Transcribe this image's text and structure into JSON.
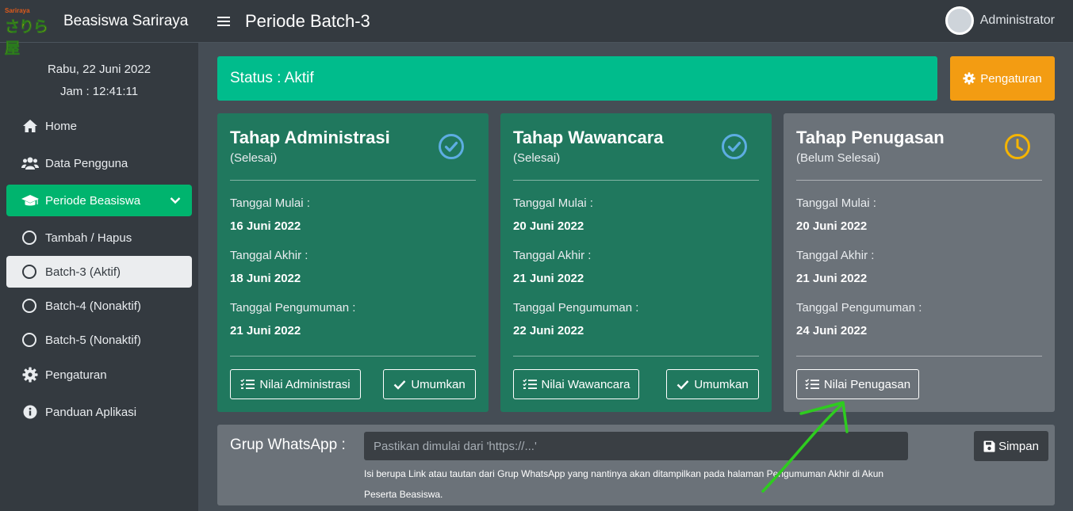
{
  "brand": {
    "logo_small": "Sariraya",
    "logo_big": "さりら屋",
    "name": "Beasiswa Sariraya"
  },
  "datetime": {
    "date": "Rabu, 22 Juni 2022",
    "time": "Jam : 12:41:11"
  },
  "nav": {
    "home": "Home",
    "users": "Data Pengguna",
    "periods": "Periode Beasiswa",
    "sub": [
      "Tambah / Hapus",
      "Batch-3 (Aktif)",
      "Batch-4 (Nonaktif)",
      "Batch-5 (Nonaktif)"
    ],
    "settings": "Pengaturan",
    "guide": "Panduan Aplikasi"
  },
  "header": {
    "title": "Periode Batch-3",
    "user": "Administrator"
  },
  "status": {
    "text": "Status : Aktif",
    "settings_button": "Pengaturan"
  },
  "labels": {
    "start": "Tanggal Mulai :",
    "end": "Tanggal Akhir :",
    "announce": "Tanggal Pengumuman :"
  },
  "cards": [
    {
      "title": "Tahap Administrasi",
      "status": "(Selesai)",
      "start": "16 Juni 2022",
      "end": "18 Juni 2022",
      "announce": "21 Juni 2022",
      "score_button": "Nilai Administrasi",
      "announce_button": "Umumkan"
    },
    {
      "title": "Tahap Wawancara",
      "status": "(Selesai)",
      "start": "20 Juni 2022",
      "end": "21 Juni 2022",
      "announce": "22 Juni 2022",
      "score_button": "Nilai Wawancara",
      "announce_button": "Umumkan"
    },
    {
      "title": "Tahap Penugasan",
      "status": "(Belum Selesai)",
      "start": "20 Juni 2022",
      "end": "21 Juni 2022",
      "announce": "24 Juni 2022",
      "score_button": "Nilai Penugasan"
    }
  ],
  "whatsapp": {
    "label": "Grup WhatsApp :",
    "placeholder": "Pastikan dimulai dari 'https://...'",
    "help": "Isi berupa Link atau tautan dari Grup WhatsApp yang nantinya akan ditampilkan pada halaman Pengumuman Akhir di Akun Peserta Beasiswa.",
    "save_button": "Simpan"
  },
  "colors": {
    "accent": "#00bc8c",
    "active_card": "#20785e",
    "warning": "#f39c12",
    "check": "#5dade2",
    "clock": "#f5b400",
    "annotation_arrow": "#2ecc1f"
  },
  "icons": {
    "check": "check-circle-icon",
    "clock": "clock-icon"
  }
}
